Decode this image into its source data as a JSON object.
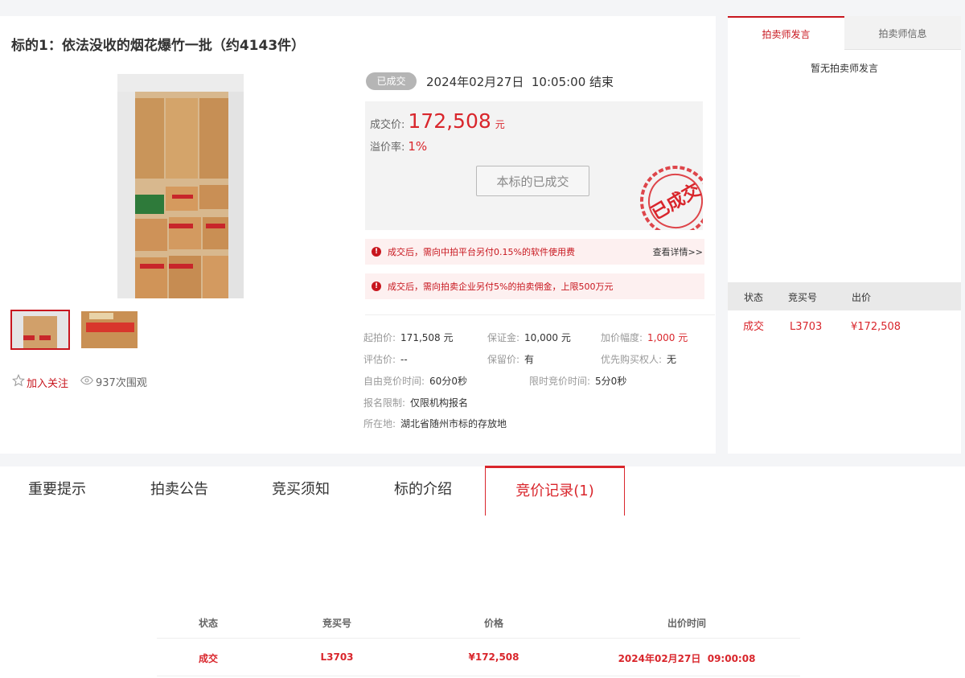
{
  "lot": {
    "title": "标的1：依法没收的烟花爆竹一批（约4143件）",
    "follow_label": "加入关注",
    "views_label": "937次围观"
  },
  "status": {
    "badge": "已成交",
    "end_time": "2024年02月27日  10:05:00 结束"
  },
  "price_box": {
    "deal_label": "成交价:",
    "deal_value": "172,508",
    "deal_unit": "元",
    "premium_label": "溢价率:",
    "premium_value": "1%",
    "button_label": "本标的已成交",
    "stamp_text": "已成交"
  },
  "notices": [
    {
      "text": "成交后，需向中拍平台另付0.15%的软件使用费",
      "link": "查看详情>>"
    },
    {
      "text": "成交后，需向拍卖企业另付5%的拍卖佣金，上限500万元"
    }
  ],
  "info": {
    "start_price_label": "起拍价:",
    "start_price": "171,508 元",
    "deposit_label": "保证金:",
    "deposit": "10,000 元",
    "increment_label": "加价幅度:",
    "increment": "1,000 元",
    "appraisal_label": "评估价:",
    "appraisal": "--",
    "reserve_label": "保留价:",
    "reserve": "有",
    "priority_label": "优先购买权人:",
    "priority": "无",
    "free_time_label": "自由竞价时间:",
    "free_time": "60分0秒",
    "limited_time_label": "限时竞价时间:",
    "limited_time": "5分0秒",
    "restriction_label": "报名限制:",
    "restriction": "仅限机构报名",
    "location_label": "所在地:",
    "location": "湖北省随州市标的存放地"
  },
  "sidebar": {
    "tab_active": "拍卖师发言",
    "tab_inactive": "拍卖师信息",
    "empty_text": "暂无拍卖师发言",
    "headers": [
      "状态",
      "竞买号",
      "出价"
    ],
    "row": {
      "status": "成交",
      "bidder": "L3703",
      "price": "¥172,508"
    }
  },
  "tabs": [
    "重要提示",
    "拍卖公告",
    "竞买须知",
    "标的介绍",
    "竞价记录(1)"
  ],
  "records": {
    "headers": [
      "状态",
      "竞买号",
      "价格",
      "出价时间"
    ],
    "rows": [
      {
        "status": "成交",
        "bidder": "L3703",
        "price": "¥172,508",
        "time": "2024年02月27日  09:00:08"
      }
    ]
  },
  "colors": {
    "accent": "#d9262c",
    "badge_gray": "#b5b5b5",
    "notice_bg": "#fdf0f0"
  }
}
